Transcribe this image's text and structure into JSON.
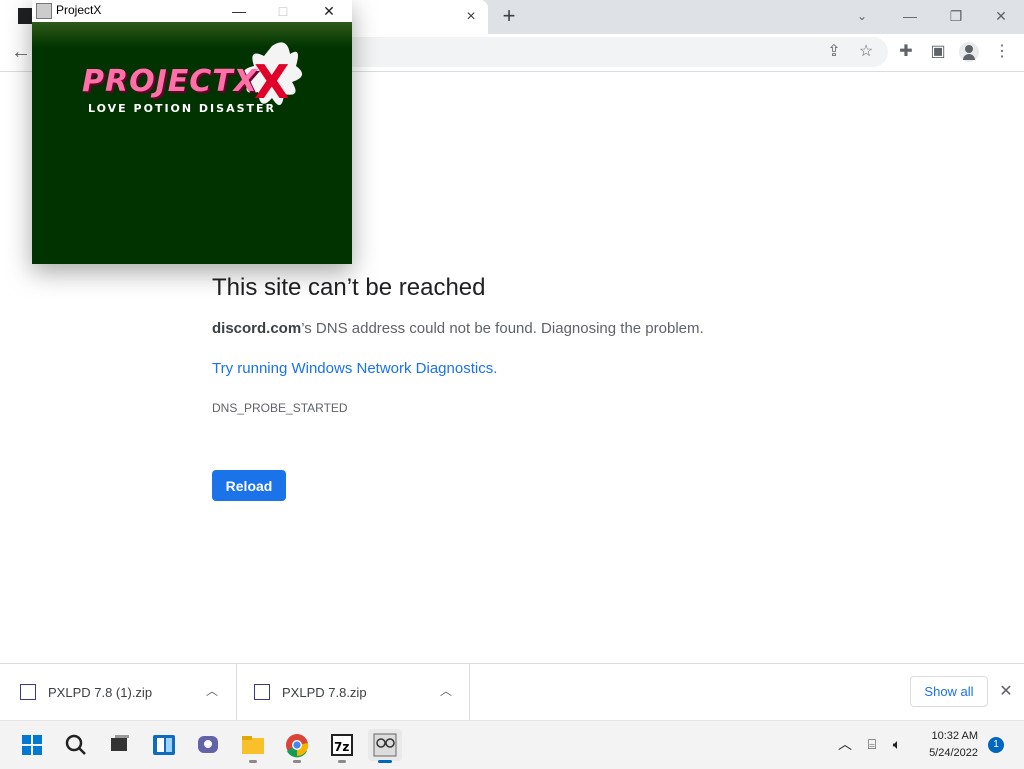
{
  "browser": {
    "tab_close_glyph": "×",
    "new_tab_glyph": "+",
    "tab_search_glyph": "⌄",
    "window_controls": [
      "—",
      "❐",
      "✕"
    ],
    "back_glyph": "←",
    "toolbar_icons": [
      "share-icon",
      "star-icon",
      "extensions-icon",
      "side-panel-icon",
      "profile-icon",
      "menu-icon"
    ]
  },
  "error_page": {
    "title": "This site can’t be reached",
    "domain": "discord.com",
    "message_rest": "’s DNS address could not be found. Diagnosing the problem.",
    "link": "Try running Windows Network Diagnostics",
    "link_suffix": ".",
    "code": "DNS_PROBE_STARTED",
    "reload_label": "Reload",
    "reload_color": "#1a73e8"
  },
  "projectx_window": {
    "title": "ProjectX",
    "controls": [
      "—",
      "□",
      "✕"
    ],
    "logo_text": "PROJECTX",
    "logo_subtitle": "LOVE POTION DISASTER",
    "background_color": "#003300"
  },
  "downloads": {
    "items": [
      {
        "name": "PXLPD 7.8 (1).zip"
      },
      {
        "name": "PXLPD 7.8.zip"
      }
    ],
    "show_all_label": "Show all",
    "close_glyph": "✕"
  },
  "taskbar": {
    "apps": [
      "start-icon",
      "search-icon",
      "task-view-icon",
      "widgets-icon",
      "chat-icon",
      "file-explorer-icon",
      "chrome-icon",
      "7zip-icon",
      "projectx-icon"
    ],
    "time": "10:32 AM",
    "date": "5/24/2022",
    "notification_count": "1"
  }
}
